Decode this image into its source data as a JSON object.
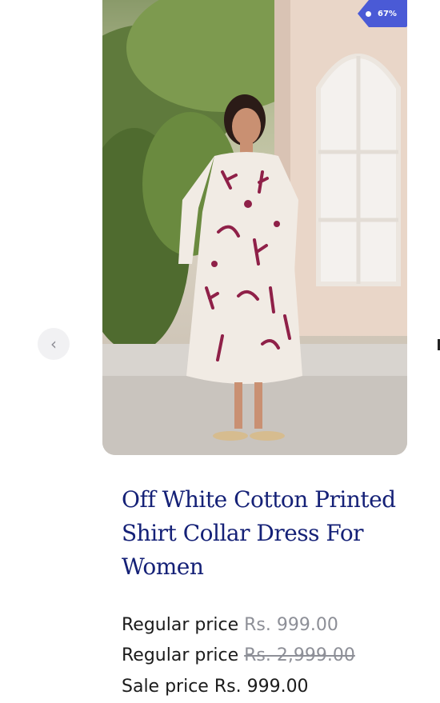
{
  "carousel": {
    "badge": {
      "discount": "67%"
    },
    "image_alt": "Off White Cotton Printed Shirt Collar Dress For Women",
    "prev_icon": "chevron-left-icon"
  },
  "product": {
    "title": "Off White Cotton Printed Shirt Collar Dress For Women",
    "prices": [
      {
        "label": "Regular price",
        "value": "Rs. 999.00"
      },
      {
        "label": "Regular price",
        "value": "Rs. 2,999.00"
      },
      {
        "label": "Sale price",
        "value": "Rs. 999.00"
      }
    ]
  },
  "colors": {
    "title": "#152177",
    "badge": "#4a5ad6",
    "muted_price": "#8d8f97"
  }
}
